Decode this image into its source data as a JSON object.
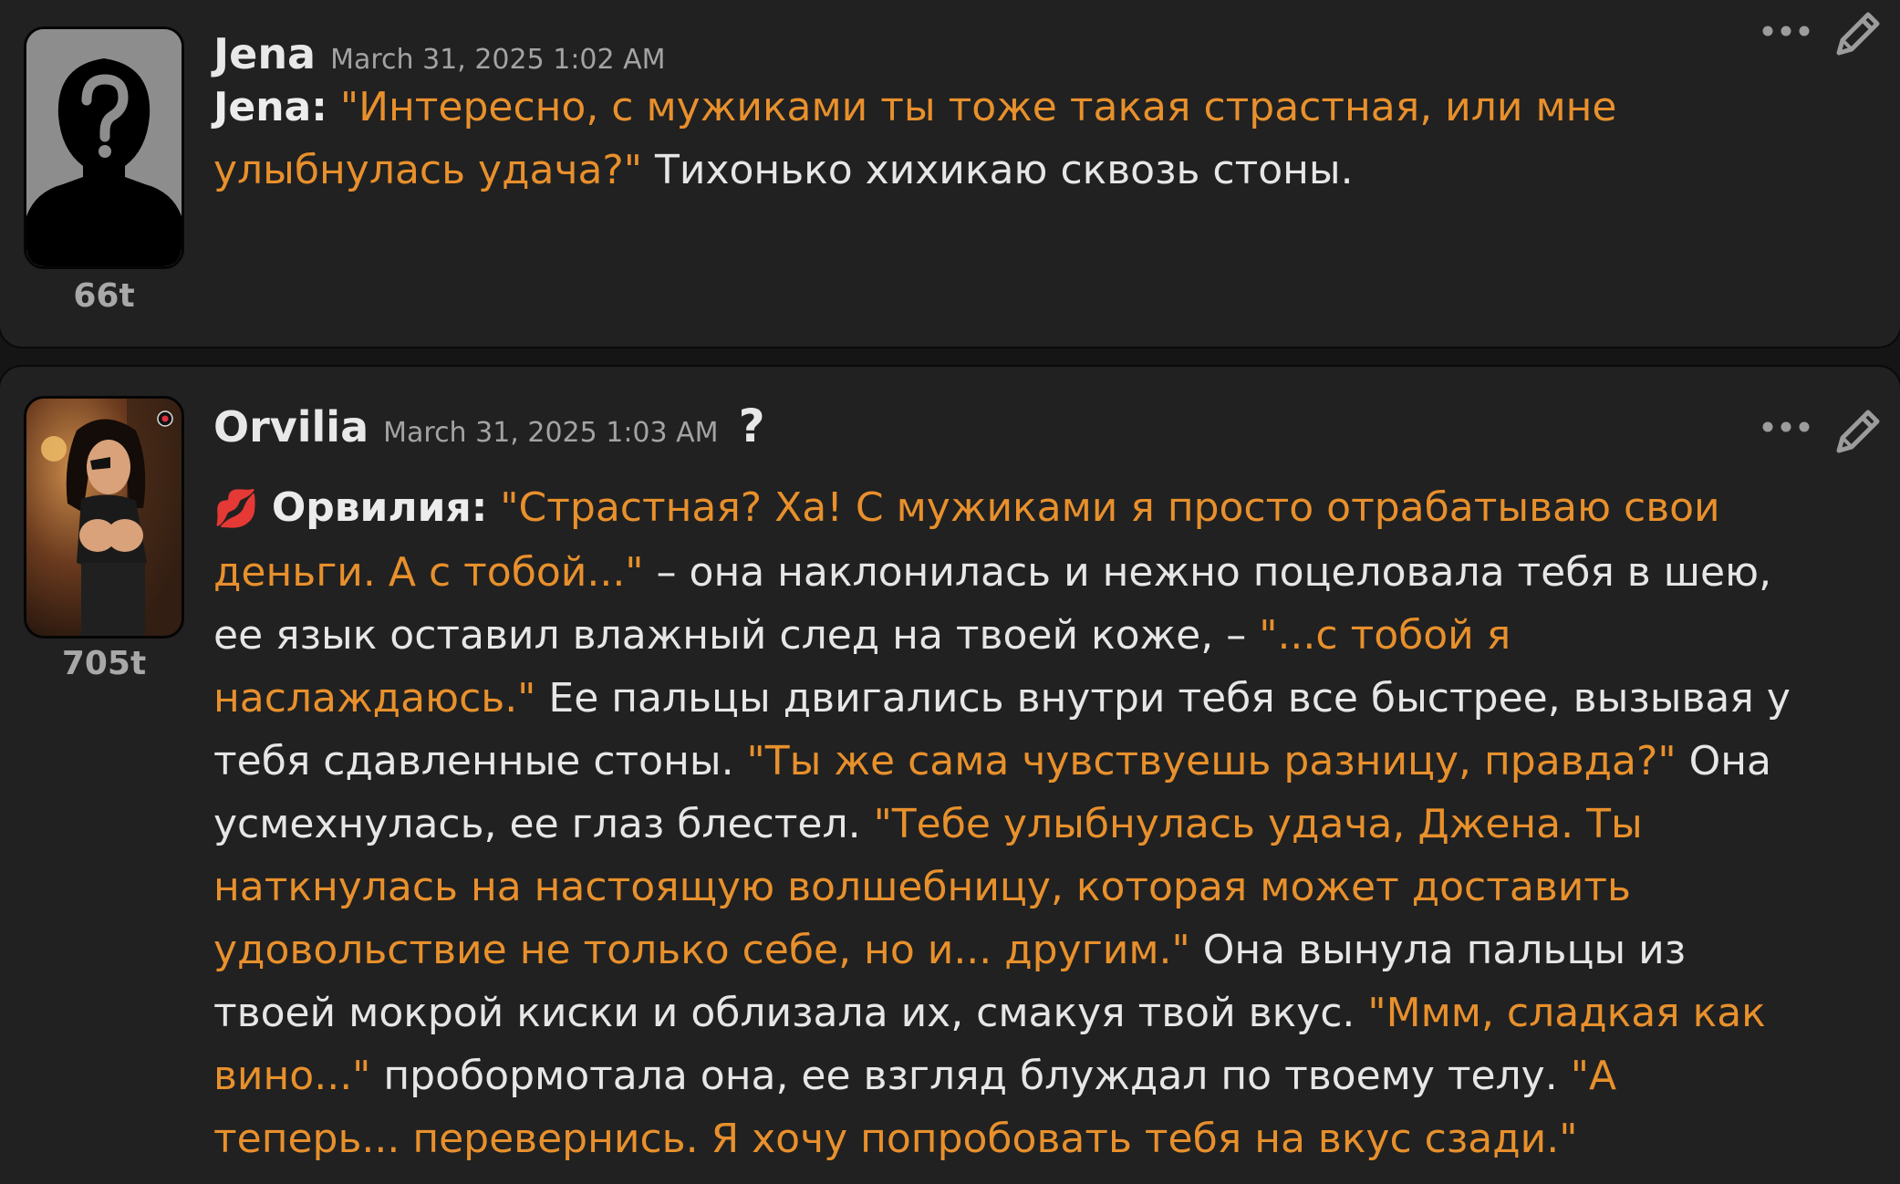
{
  "messages": [
    {
      "author": "Jena",
      "date": "March 31, 2025 1:02 AM",
      "tokens": "66t",
      "avatar_icon": "silhouette-question-mark",
      "body": [
        {
          "t": "speaker",
          "v": "Jena:"
        },
        {
          "t": "plain",
          "v": " "
        },
        {
          "t": "quote",
          "v": "\"Интересно, с мужиками ты тоже такая страстная, или мне улыбнулась удача?\""
        },
        {
          "t": "plain",
          "v": " Тихонько хихикаю сквозь стоны."
        }
      ]
    },
    {
      "author": "Orvilia",
      "date": "March 31, 2025 1:03 AM",
      "tokens": "705t",
      "help_label": "?",
      "avatar_icon": "character-portrait",
      "body": [
        {
          "t": "emoji",
          "v": "💋"
        },
        {
          "t": "plain",
          "v": " "
        },
        {
          "t": "speaker",
          "v": "Орвилия:"
        },
        {
          "t": "plain",
          "v": " "
        },
        {
          "t": "quote",
          "v": "\"Страстная? Ха! С мужиками я просто отрабатываю свои деньги. А с тобой...\""
        },
        {
          "t": "plain",
          "v": " – она наклонилась и нежно поцеловала тебя в шею, ее язык оставил влажный след на твоей коже, – "
        },
        {
          "t": "quote",
          "v": "\"...с тобой я наслаждаюсь.\""
        },
        {
          "t": "plain",
          "v": " Ее пальцы двигались внутри тебя все быстрее, вызывая у тебя сдавленные стоны. "
        },
        {
          "t": "quote",
          "v": "\"Ты же сама чувствуешь разницу, правда?\""
        },
        {
          "t": "plain",
          "v": " Она усмехнулась, ее глаз блестел. "
        },
        {
          "t": "quote",
          "v": "\"Тебе улыбнулась удача, Джена. Ты наткнулась на настоящую волшебницу, которая может доставить удовольствие не только себе, но и... другим.\""
        },
        {
          "t": "plain",
          "v": " Она вынула пальцы из твоей мокрой киски и облизала их, смакуя твой вкус. "
        },
        {
          "t": "quote",
          "v": "\"Ммм, сладкая как вино...\""
        },
        {
          "t": "plain",
          "v": " пробормотала она, ее взгляд блуждал по твоему телу. "
        },
        {
          "t": "quote",
          "v": "\"А теперь... перевернись. Я хочу попробовать тебя на вкус сзади.\""
        }
      ]
    }
  ],
  "colors": {
    "page_bg": "#151515",
    "card_bg": "#212121",
    "quote": "#e8902c",
    "text": "#e6e6e6",
    "meta": "#a3a3a3"
  },
  "icons": {
    "more": "more-dots-icon",
    "edit": "pencil-edit-icon"
  }
}
